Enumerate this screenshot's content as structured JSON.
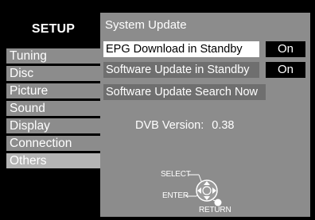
{
  "sidebar": {
    "title": "SETUP",
    "items": [
      {
        "label": "Tuning",
        "active": false
      },
      {
        "label": "Disc",
        "active": false
      },
      {
        "label": "Picture",
        "active": false
      },
      {
        "label": "Sound",
        "active": false
      },
      {
        "label": "Display",
        "active": false
      },
      {
        "label": "Connection",
        "active": false
      },
      {
        "label": "Others",
        "active": true
      }
    ]
  },
  "panel": {
    "title": "System Update",
    "rows": [
      {
        "label": "EPG Download in Standby",
        "value": "On",
        "selected": true
      },
      {
        "label": "Software Update in Standby",
        "value": "On",
        "selected": false
      },
      {
        "label": "Software Update Search Now",
        "value": null,
        "selected": false
      }
    ],
    "version_label": "DVB Version:",
    "version_value": "0.38"
  },
  "hint": {
    "select": "SELECT",
    "enter": "ENTER",
    "return": "RETURN",
    "icon": "dpad-remote-icon"
  },
  "colors": {
    "background": "#000000",
    "panel": "#8c8c8c",
    "row_dark": "#6f6f6f",
    "highlight": "#ffffff",
    "active_menu": "#b4b4b4"
  }
}
